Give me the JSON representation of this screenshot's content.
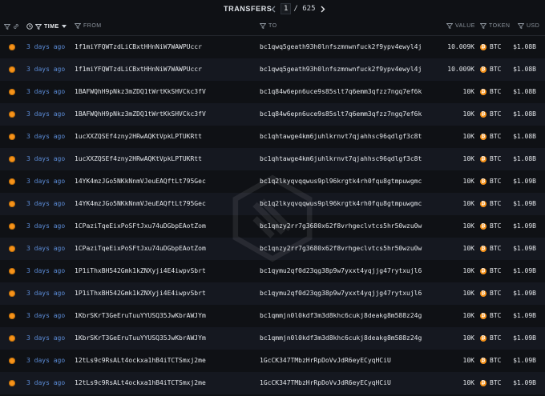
{
  "page": {
    "title": "TRANSFERS"
  },
  "pager": {
    "current": "1",
    "separator": "/",
    "total": "625"
  },
  "columns": {
    "time": "TIME",
    "from": "FROM",
    "to": "TO",
    "value": "VALUE",
    "token": "TOKEN",
    "usd": "USD"
  },
  "colors": {
    "accent_orange": "#f7931a",
    "link_blue": "#5b8bd6",
    "background": "#0f1115"
  },
  "rows": [
    {
      "time": "3 days ago",
      "from": "1f1miYFQWTzdLiCBxtHHnNiW7WAWPUccr",
      "to": "bc1qwq5geath93h0lnfszmnwnfuck2f9ypv4ewyl4j",
      "value": "10.009K",
      "token": "BTC",
      "usd": "$1.08B"
    },
    {
      "time": "3 days ago",
      "from": "1f1miYFQWTzdLiCBxtHHnNiW7WAWPUccr",
      "to": "bc1qwq5geath93h0lnfszmnwnfuck2f9ypv4ewyl4j",
      "value": "10.009K",
      "token": "BTC",
      "usd": "$1.08B"
    },
    {
      "time": "3 days ago",
      "from": "1BAFWQhH9pNkz3mZDQ1tWrtKkSHVCkc3fV",
      "to": "bc1q84w6epn6uce9s85slt7q6emm3qfzz7ngq7ef6k",
      "value": "10K",
      "token": "BTC",
      "usd": "$1.08B"
    },
    {
      "time": "3 days ago",
      "from": "1BAFWQhH9pNkz3mZDQ1tWrtKkSHVCkc3fV",
      "to": "bc1q84w6epn6uce9s85slt7q6emm3qfzz7ngq7ef6k",
      "value": "10K",
      "token": "BTC",
      "usd": "$1.08B"
    },
    {
      "time": "3 days ago",
      "from": "1ucXXZQSEf4zny2HRwAQKtVpkLPTUKRtt",
      "to": "bc1qhtawge4km6juhlkrnvt7qjahhsc96qdlgf3c8t",
      "value": "10K",
      "token": "BTC",
      "usd": "$1.08B"
    },
    {
      "time": "3 days ago",
      "from": "1ucXXZQSEf4zny2HRwAQKtVpkLPTUKRtt",
      "to": "bc1qhtawge4km6juhlkrnvt7qjahhsc96qdlgf3c8t",
      "value": "10K",
      "token": "BTC",
      "usd": "$1.08B"
    },
    {
      "time": "3 days ago",
      "from": "14YK4mzJGo5NKkNnmVJeuEAQftLt795Gec",
      "to": "bc1q2lkyqvqqwus9pl96krgtk4rh0fqu8gtmpuwgmc",
      "value": "10K",
      "token": "BTC",
      "usd": "$1.09B"
    },
    {
      "time": "3 days ago",
      "from": "14YK4mzJGo5NKkNnmVJeuEAQftLt795Gec",
      "to": "bc1q2lkyqvqqwus9pl96krgtk4rh0fqu8gtmpuwgmc",
      "value": "10K",
      "token": "BTC",
      "usd": "$1.09B"
    },
    {
      "time": "3 days ago",
      "from": "1CPaziTqeEixPoSFtJxu74uDGbpEAotZom",
      "to": "bc1qnzy2rr7g3680x62f8vrhgeclvtcs5hr50wzu0w",
      "value": "10K",
      "token": "BTC",
      "usd": "$1.09B"
    },
    {
      "time": "3 days ago",
      "from": "1CPaziTqeEixPoSFtJxu74uDGbpEAotZom",
      "to": "bc1qnzy2rr7g3680x62f8vrhgeclvtcs5hr50wzu0w",
      "value": "10K",
      "token": "BTC",
      "usd": "$1.09B"
    },
    {
      "time": "3 days ago",
      "from": "1P1iThxBH542Gmk1kZNXyji4E4iwpvSbrt",
      "to": "bc1qymu2qf0d23qg38p9w7yxxt4yqjjg47rytxujl6",
      "value": "10K",
      "token": "BTC",
      "usd": "$1.09B"
    },
    {
      "time": "3 days ago",
      "from": "1P1iThxBH542Gmk1kZNXyji4E4iwpvSbrt",
      "to": "bc1qymu2qf0d23qg38p9w7yxxt4yqjjg47rytxujl6",
      "value": "10K",
      "token": "BTC",
      "usd": "$1.09B"
    },
    {
      "time": "3 days ago",
      "from": "1KbrSKrT3GeEruTuuYYUSQ35JwKbrAWJYm",
      "to": "bc1qmmjn0l0kdf3m3d8khc6cukj8deakg8m588z24g",
      "value": "10K",
      "token": "BTC",
      "usd": "$1.09B"
    },
    {
      "time": "3 days ago",
      "from": "1KbrSKrT3GeEruTuuYYUSQ35JwKbrAWJYm",
      "to": "bc1qmmjn0l0kdf3m3d8khc6cukj8deakg8m588z24g",
      "value": "10K",
      "token": "BTC",
      "usd": "$1.09B"
    },
    {
      "time": "3 days ago",
      "from": "12tLs9c9RsALt4ockxa1hB4iTCTSmxj2me",
      "to": "1GcCK347TMbzHrRpDoVvJdR6eyECyqHCiU",
      "value": "10K",
      "token": "BTC",
      "usd": "$1.09B"
    },
    {
      "time": "3 days ago",
      "from": "12tLs9c9RsALt4ockxa1hB4iTCTSmxj2me",
      "to": "1GcCK347TMbzHrRpDoVvJdR6eyECyqHCiU",
      "value": "10K",
      "token": "BTC",
      "usd": "$1.09B"
    }
  ]
}
